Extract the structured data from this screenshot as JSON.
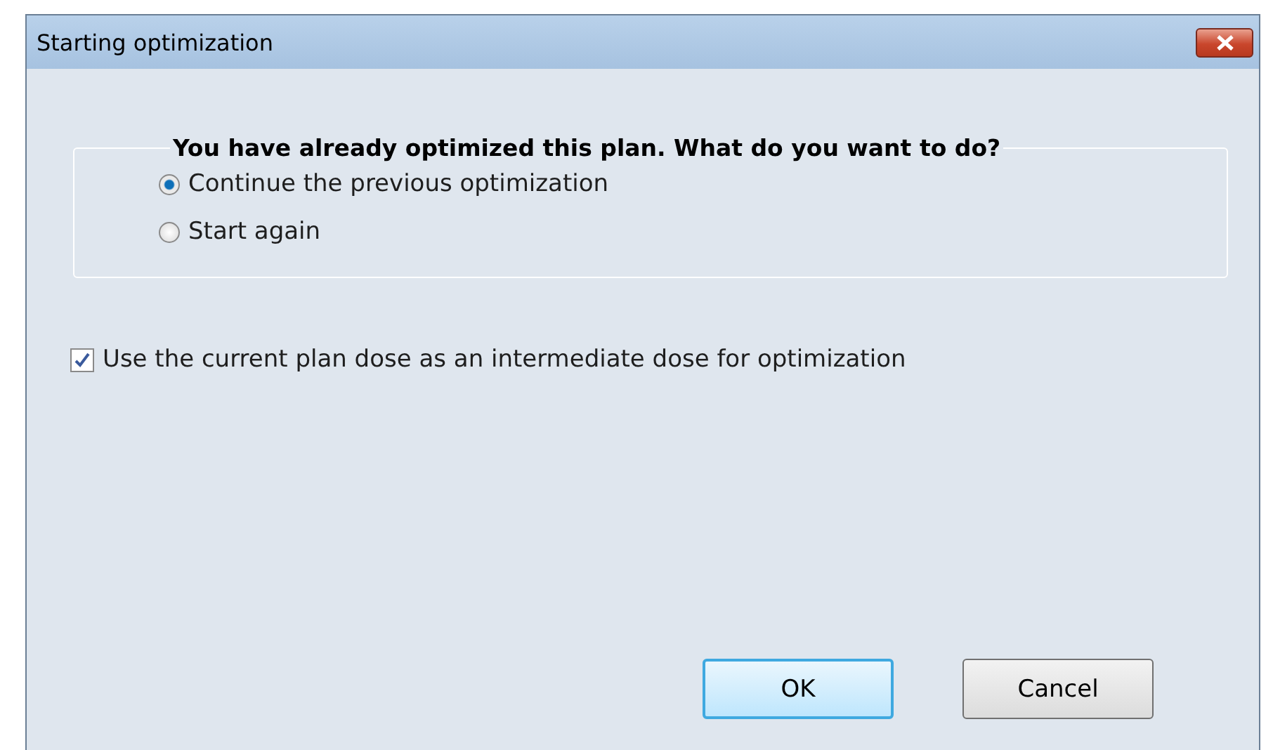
{
  "window": {
    "title": "Starting optimization"
  },
  "group": {
    "legend": "You have already optimized this plan. What do you want to do?",
    "options": [
      {
        "label": "Continue the previous optimization",
        "selected": true
      },
      {
        "label": "Start again",
        "selected": false
      }
    ]
  },
  "checkbox": {
    "label": "Use the current plan dose as an intermediate dose for optimization",
    "checked": true
  },
  "buttons": [
    {
      "label": "OK",
      "default": true
    },
    {
      "label": "Cancel",
      "default": false
    }
  ]
}
